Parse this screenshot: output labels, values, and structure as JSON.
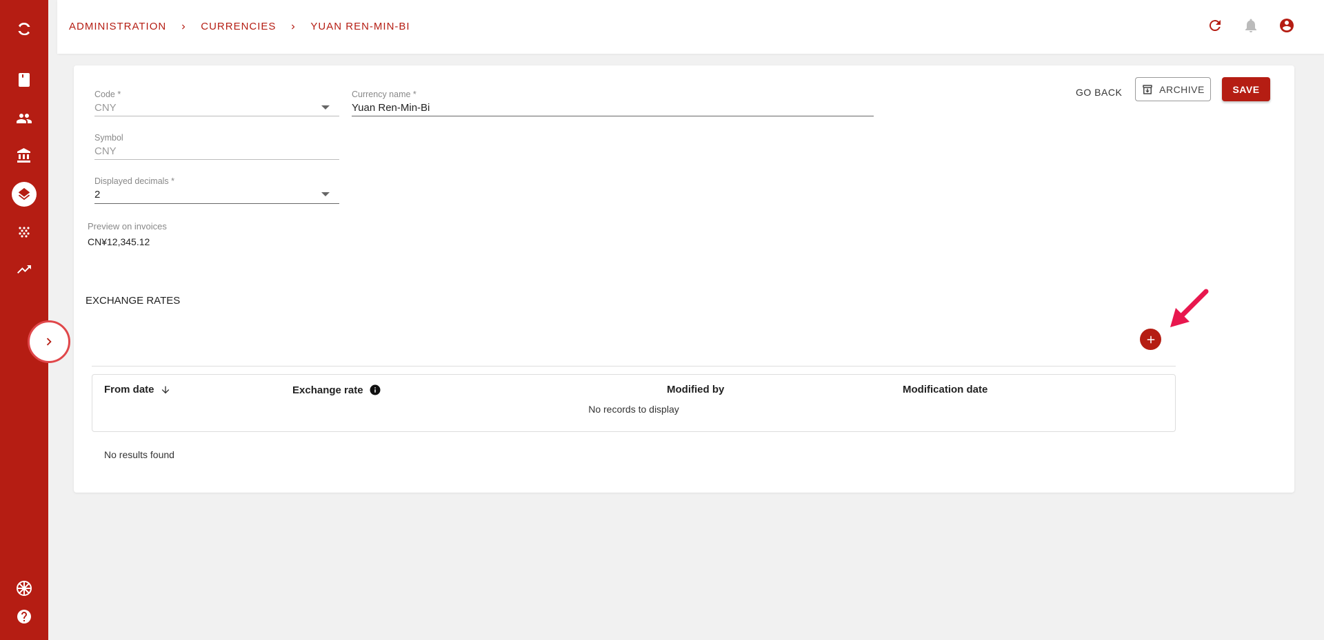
{
  "sidebar": {
    "items": [
      {
        "icon": "logo-icon"
      },
      {
        "icon": "book-icon"
      },
      {
        "icon": "users-icon"
      },
      {
        "icon": "bank-icon"
      },
      {
        "icon": "layers-icon",
        "active": true
      },
      {
        "icon": "dots-grid-icon"
      },
      {
        "icon": "trending-up-icon"
      },
      {
        "icon": "language-flag-icon"
      },
      {
        "icon": "help-icon"
      }
    ],
    "collapse_icon": "chevron-right-icon"
  },
  "header": {
    "breadcrumb": [
      "ADMINISTRATION",
      "CURRENCIES",
      "YUAN REN-MIN-BI"
    ],
    "actions": [
      "refresh-icon",
      "bell-icon",
      "account-icon"
    ]
  },
  "form": {
    "code": {
      "label": "Code *",
      "value": "CNY"
    },
    "currency_name": {
      "label": "Currency name *",
      "value": "Yuan Ren-Min-Bi"
    },
    "symbol": {
      "label": "Symbol",
      "value": "CNY"
    },
    "displayed_decimals": {
      "label": "Displayed decimals *",
      "value": "2"
    },
    "preview": {
      "label": "Preview on invoices",
      "value": "CN¥12,345.12"
    }
  },
  "toolbar": {
    "go_back": "GO BACK",
    "archive": "ARCHIVE",
    "save": "SAVE"
  },
  "exchange_rates": {
    "title": "EXCHANGE RATES",
    "columns": [
      "From date",
      "Exchange rate",
      "Modified by",
      "Modification date"
    ],
    "empty_message": "No records to display",
    "footer": "No results found"
  },
  "colors": {
    "brand": "#b51d13",
    "annotation_arrow": "#e8174e"
  }
}
